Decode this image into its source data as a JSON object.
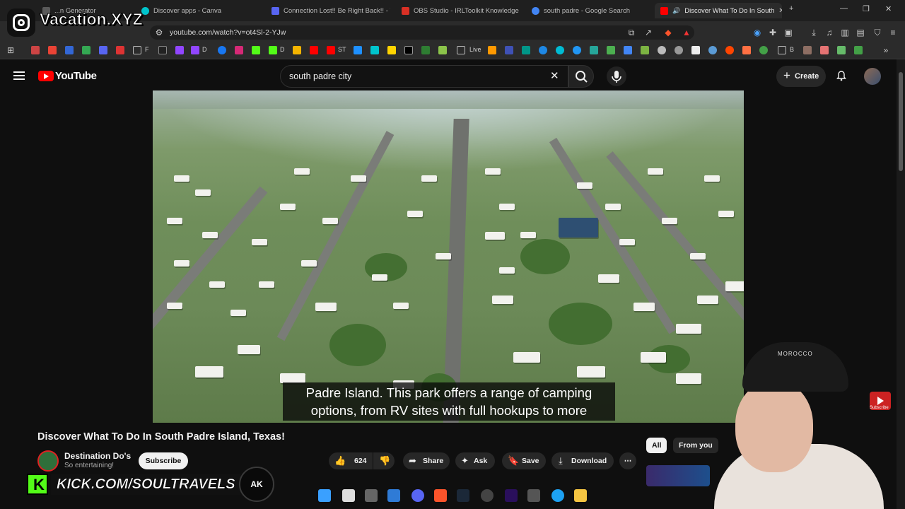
{
  "tabs": [
    {
      "label": "...n Generator",
      "color": "#5a5a5a"
    },
    {
      "label": "Discover apps - Canva",
      "color": "#00c4cc"
    },
    {
      "label": "Connection Lost!! Be Right Back!! - Y",
      "color": "#5865f2"
    },
    {
      "label": "OBS Studio - IRLToolkit Knowledge B",
      "color": "#d93025"
    },
    {
      "label": "south padre - Google Search",
      "color": "#4285f4"
    },
    {
      "label": "Discover What To Do In South",
      "color": "#ff0000"
    }
  ],
  "address": {
    "url": "youtube.com/watch?v=ot4Sl-2-YJw"
  },
  "bookmarks": [
    {
      "label": "F"
    },
    {
      "label": "D"
    },
    {
      "label": "D"
    },
    {
      "label": "ST"
    },
    {
      "label": "Live"
    },
    {
      "label": "B"
    }
  ],
  "youtube": {
    "logo_text": "YouTube",
    "search_value": "south padre city",
    "create_label": "Create",
    "video": {
      "caption_line1": "Padre Island. This park offers a range of camping",
      "caption_line2": "options, from RV sites with full hookups to more",
      "title": "Discover What To Do In South Padre Island, Texas!"
    },
    "channel": {
      "name": "Destination Do's",
      "subscribers": "So entertaining!",
      "subscribe_label": "Subscribe"
    },
    "actions": {
      "like_count": "624",
      "share_label": "Share",
      "ask_label": "Ask",
      "save_label": "Save",
      "download_label": "Download"
    },
    "chips": {
      "all": "All",
      "from_you": "From you"
    }
  },
  "overlays": {
    "instagram_handle": "Vacation.XYZ",
    "kick_url": "KICK.COM/SOULTRAVELS",
    "ak_badge": "AK",
    "hat_text": "MOROCCO",
    "subscribe_small": "Subscribe"
  },
  "colors": {
    "youtube_red": "#ff0000",
    "kick_green": "#53fc18",
    "page_bg": "#0f0f0f"
  }
}
